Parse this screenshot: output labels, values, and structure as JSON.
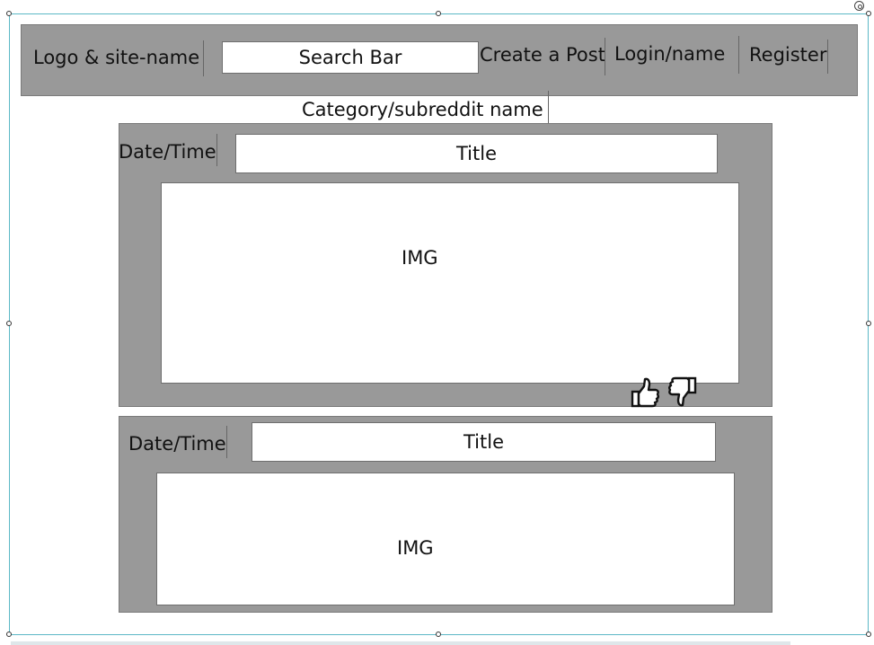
{
  "header": {
    "logo_label": "Logo & site-name",
    "search_label": "Search Bar",
    "create_post_label": "Create a Post",
    "login_label": "Login/name",
    "register_label": "Register"
  },
  "category": {
    "label": "Category/subreddit name"
  },
  "posts": [
    {
      "date_label": "Date/Time",
      "title_label": "Title",
      "img_label": "IMG",
      "upvote_icon": "thumbs-up-icon",
      "downvote_icon": "thumbs-down-icon"
    },
    {
      "date_label": "Date/Time",
      "title_label": "Title",
      "img_label": "IMG"
    }
  ],
  "colors": {
    "panel_grey": "#999999",
    "selection_blue": "#5cb8c6"
  }
}
